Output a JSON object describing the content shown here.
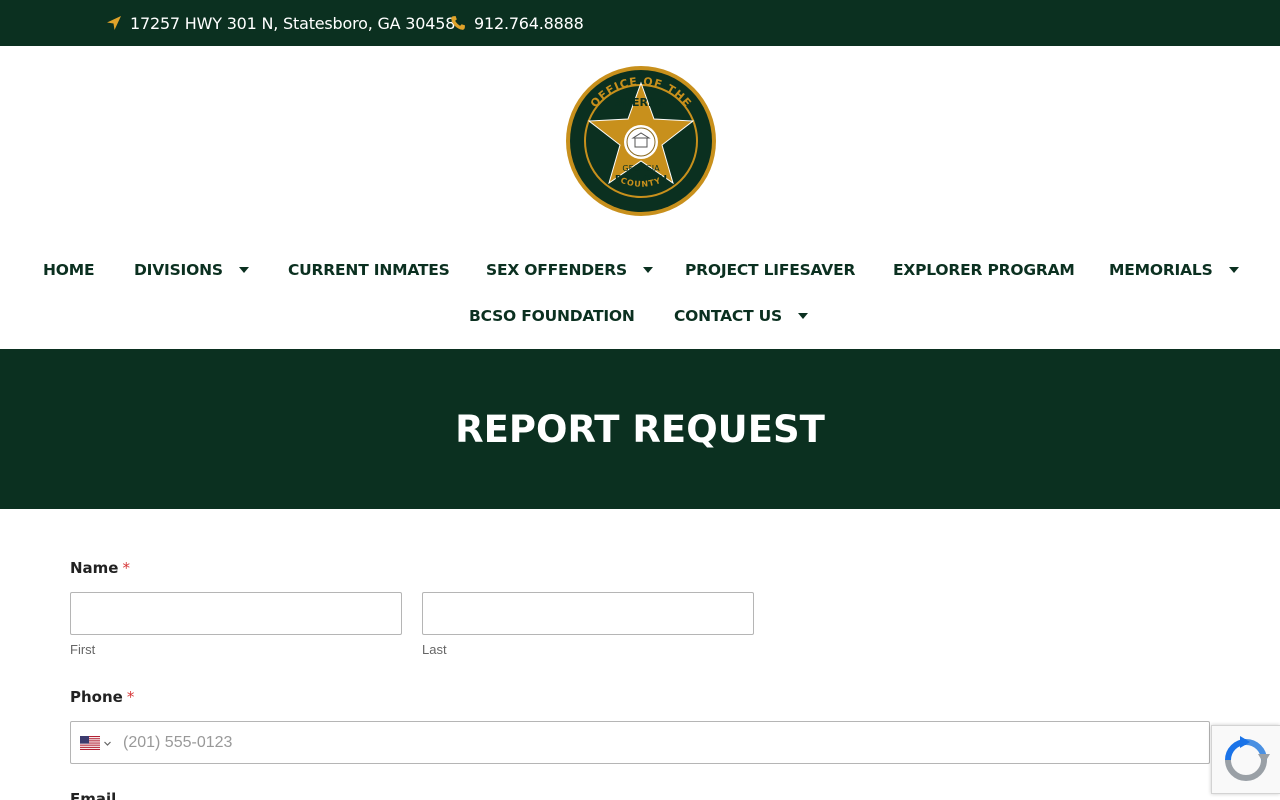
{
  "topbar": {
    "address": "17257 HWY 301 N, Statesboro, GA 30458",
    "phone": "912.764.8888",
    "accent_color": "#e0a32a",
    "background": "#0b3020"
  },
  "logo": {
    "ring_top": "OFFICE OF THE",
    "star_top": "SHERIFF",
    "star_bottom": "GEORGIA",
    "county_name": "BULLOCH",
    "ring_bottom": "COUNTY"
  },
  "nav": {
    "home": "HOME",
    "divisions": "DIVISIONS",
    "current_inmates": "CURRENT INMATES",
    "sex_offenders": "SEX OFFENDERS",
    "project_lifesaver": "PROJECT LIFESAVER",
    "explorer_program": "EXPLORER PROGRAM",
    "memorials": "MEMORIALS",
    "bcso_foundation": "BCSO FOUNDATION",
    "contact_us": "CONTACT US"
  },
  "hero": {
    "title": "REPORT REQUEST"
  },
  "form": {
    "name_label": "Name",
    "required_mark": "*",
    "first_sublabel": "First",
    "last_sublabel": "Last",
    "first_value": "",
    "last_value": "",
    "phone_label": "Phone",
    "phone_placeholder": "(201) 555-0123",
    "phone_country_icon": "us-flag-icon",
    "next_label_partial": "Email"
  },
  "icons": {
    "address": "location-arrow-icon",
    "phone": "phone-icon",
    "recaptcha": "recaptcha-icon"
  }
}
